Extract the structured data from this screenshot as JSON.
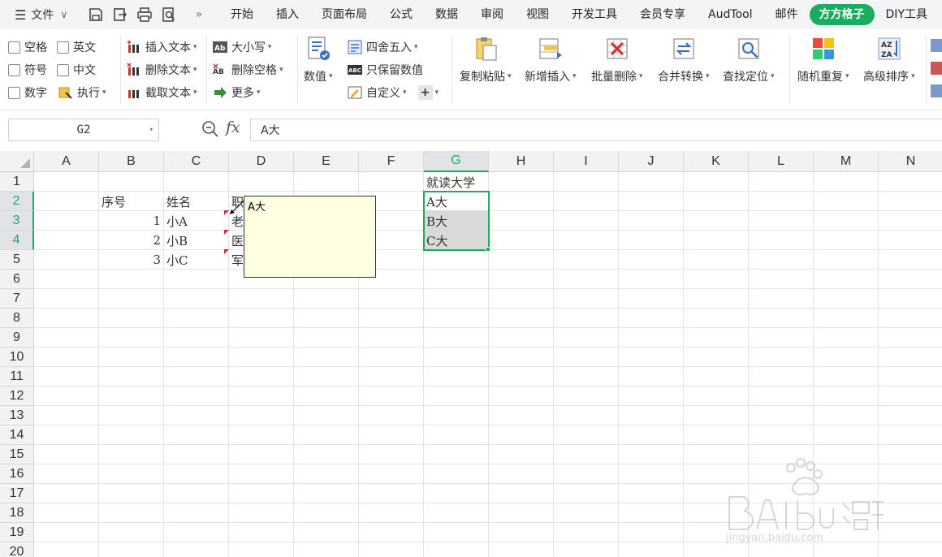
{
  "menubar": {
    "file_label": "文件",
    "more": "»",
    "tabs": [
      {
        "label": "开始"
      },
      {
        "label": "插入"
      },
      {
        "label": "页面布局"
      },
      {
        "label": "公式"
      },
      {
        "label": "数据"
      },
      {
        "label": "审阅"
      },
      {
        "label": "视图"
      },
      {
        "label": "开发工具"
      },
      {
        "label": "会员专享"
      },
      {
        "label": "AudTool"
      },
      {
        "label": "邮件"
      },
      {
        "label": "方方格子",
        "active": true
      },
      {
        "label": "DIY工具"
      }
    ]
  },
  "ribbon": {
    "checkboxes": [
      "空格",
      "英文",
      "符号",
      "中文",
      "数字"
    ],
    "execute": "执行",
    "text_ops": [
      "插入文本",
      "删除文本",
      "截取文本"
    ],
    "case_ops": [
      "大小写",
      "删除空格",
      "更多"
    ],
    "values": "数值",
    "num_ops": [
      "四舍五入",
      "只保留数值",
      "自定义"
    ],
    "plus": "+",
    "big_buttons": [
      "复制粘贴",
      "新增插入",
      "批量删除",
      "合并转换",
      "查找定位",
      "随机重复",
      "高级排序"
    ]
  },
  "formula_bar": {
    "name_box": "G2",
    "fx": "fx",
    "content": "A大"
  },
  "sheet": {
    "columns": [
      "A",
      "B",
      "C",
      "D",
      "E",
      "F",
      "G",
      "H",
      "I",
      "J",
      "K",
      "L",
      "M",
      "N"
    ],
    "rows": [
      "1",
      "2",
      "3",
      "4",
      "5",
      "6",
      "7",
      "8",
      "9",
      "10",
      "11",
      "12",
      "13",
      "14",
      "15",
      "16",
      "17",
      "18",
      "19",
      "20"
    ],
    "cells": {
      "G1": "就读大学",
      "B2": "序号",
      "C2": "姓名",
      "D2": "职",
      "B3": "1",
      "C3": "小A",
      "D3": "老",
      "B4": "2",
      "C4": "小B",
      "D4": "医",
      "B5": "3",
      "C5": "小C",
      "D5": "军",
      "G2": "A大",
      "G3": "B大",
      "G4": "C大"
    },
    "comment_popup": "A大",
    "selected_column": "G",
    "selected_rows": [
      "2",
      "3",
      "4"
    ]
  },
  "watermark": {
    "brand": "Baidu经验",
    "url": "jingyan.baidu.com"
  },
  "colors": {
    "accent": "#1aad60",
    "comment_bg": "#ffffe1",
    "comment_marker": "#d32f2f"
  }
}
